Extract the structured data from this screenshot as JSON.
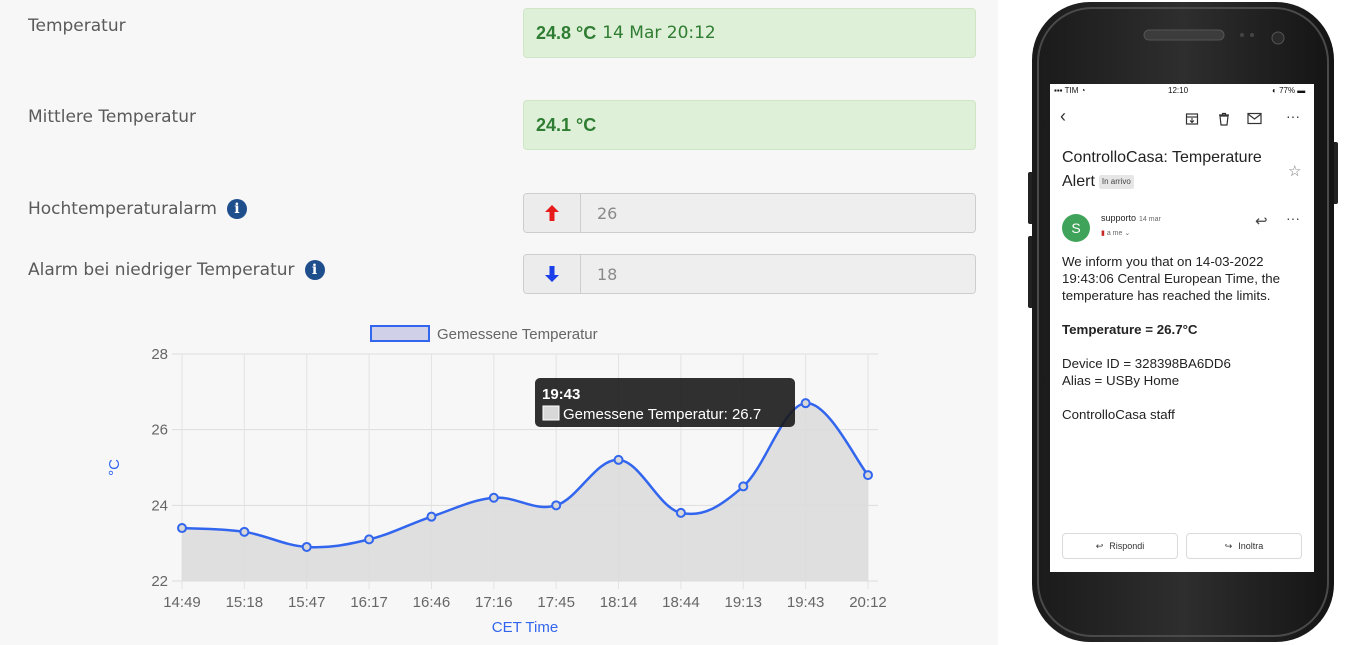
{
  "dashboard": {
    "temperature": {
      "label": "Temperatur",
      "value": "24.8 °C",
      "timestamp": "14 Mar 20:12"
    },
    "avg_temperature": {
      "label": "Mittlere Temperatur",
      "value": "24.1 °C"
    },
    "high_alarm": {
      "label": "Hochtemperaturalarm",
      "value": "26",
      "icon": "arrow-up-icon",
      "color": "#e81b1b"
    },
    "low_alarm": {
      "label": "Alarm bei niedriger Temperatur",
      "value": "18",
      "icon": "arrow-down-icon",
      "color": "#1b3fe8"
    },
    "info_glyph": "i"
  },
  "chart_data": {
    "type": "line",
    "x": [
      "14:49",
      "15:18",
      "15:47",
      "16:17",
      "16:46",
      "17:16",
      "17:45",
      "18:14",
      "18:44",
      "19:13",
      "19:43",
      "20:12"
    ],
    "series": [
      {
        "name": "Gemessene Temperatur",
        "values": [
          23.4,
          23.3,
          22.9,
          23.1,
          23.7,
          24.2,
          24.0,
          25.2,
          23.8,
          24.5,
          26.7,
          24.8
        ]
      }
    ],
    "ylim": [
      22,
      28
    ],
    "yticks": [
      "22",
      "24",
      "26",
      "28"
    ],
    "xlabel": "CET Time",
    "ylabel": "°C",
    "legend": "top-center",
    "grid": true,
    "line_color": "#3366ee",
    "fill_color": "#dcdcdc",
    "tooltip": {
      "title": "19:43",
      "text": "Gemessene Temperatur: 26.7",
      "index": 10
    }
  },
  "phone": {
    "status": {
      "carrier": "TIM",
      "time": "12:10",
      "battery": "77%"
    },
    "icons": {
      "back": "back-icon",
      "archive": "archive-icon",
      "delete": "trash-icon",
      "mail": "mail-icon",
      "more": "more-icon",
      "star": "star-icon",
      "reply": "reply-icon",
      "forward": "forward-icon"
    },
    "email": {
      "subject": "ControlloCasa: Temperature Alert",
      "tag": "In arrivo",
      "avatar_letter": "S",
      "sender": "supporto",
      "date": "14 mar",
      "recipient": "a me",
      "body_intro": "We inform you that on 14-03-2022 19:43:06 Central European Time, the temperature has reached the limits.",
      "temperature_line": "Temperature = 26.7°C",
      "device_id": "Device ID = 328398BA6DD6",
      "alias": "Alias = USBy Home",
      "signature": "ControlloCasa staff"
    },
    "actions": {
      "reply": "Rispondi",
      "forward": "Inoltra"
    }
  }
}
